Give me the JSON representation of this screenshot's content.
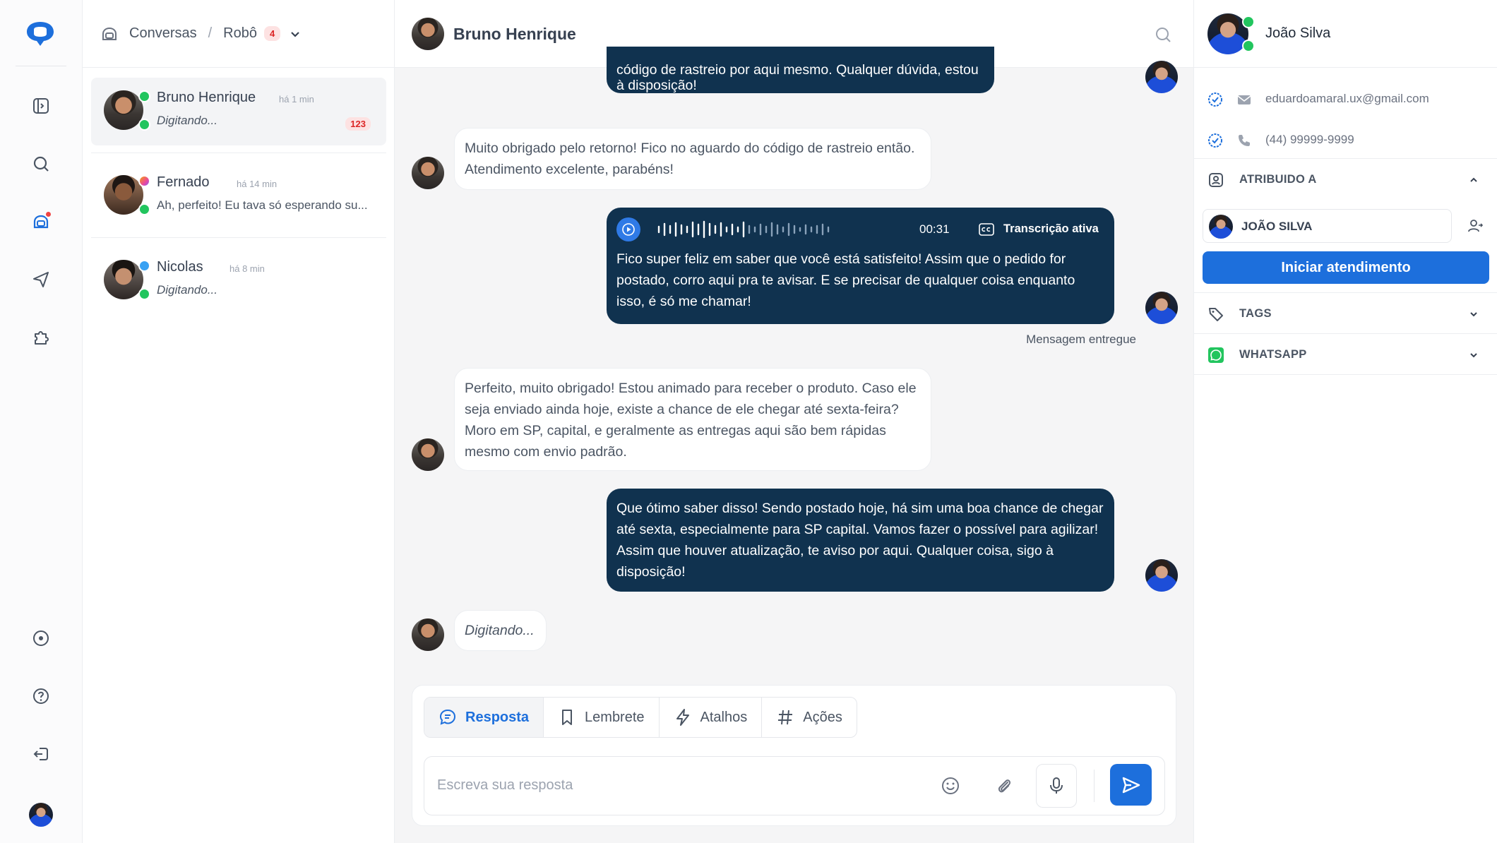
{
  "colors": {
    "accent": "#1d6fdc",
    "outgoing_bubble": "#10324f",
    "online": "#22c55e",
    "badge_bg": "#fde2e2",
    "badge_text": "#dc2626"
  },
  "rail": {
    "icons": [
      "chat-logo-icon",
      "panel-toggle-icon",
      "search-icon",
      "robot-icon",
      "send-icon",
      "puzzle-icon",
      "help-circle-icon",
      "question-icon",
      "logout-icon",
      "user-avatar"
    ]
  },
  "breadcrumb": {
    "root": "Conversas",
    "current": "Robô",
    "count": "4"
  },
  "conversations": [
    {
      "name": "Bruno Henrique",
      "time": "há 1 min",
      "preview": "Digitando...",
      "unread": "123",
      "channel": "whatsapp"
    },
    {
      "name": "Fernado",
      "time": "há 14 min",
      "preview": "Ah, perfeito! Eu tava só esperando su...",
      "unread": "",
      "channel": "instagram"
    },
    {
      "name": "Nicolas",
      "time": "há 8 min",
      "preview": "Digitando...",
      "unread": "",
      "channel": "telegram"
    }
  ],
  "chat": {
    "title": "Bruno Henrique",
    "messages": [
      {
        "dir": "out",
        "text": "código de rastreio por aqui mesmo. Qualquer dúvida, estou à disposição!"
      },
      {
        "dir": "in",
        "text": "Muito obrigado pelo retorno! Fico no aguardo do código de rastreio então. Atendimento excelente, parabéns!"
      },
      {
        "dir": "out",
        "type": "audio",
        "duration": "00:31",
        "transcription_label": "Transcrição ativa",
        "text": "Fico super feliz em saber que você está satisfeito! Assim que o pedido for postado, corro aqui pra te avisar. E se precisar de qualquer coisa enquanto isso, é só me chamar!"
      },
      {
        "dir": "in",
        "text": "Perfeito, muito obrigado! Estou animado para receber o produto. Caso ele seja enviado ainda hoje, existe a chance de ele chegar até sexta-feira? Moro em SP, capital, e geralmente as entregas aqui são bem rápidas mesmo com envio padrão."
      },
      {
        "dir": "out",
        "text": "Que ótimo saber disso! Sendo postado hoje, há sim uma boa chance de chegar até sexta, especialmente para SP capital. Vamos fazer o possível para agilizar! Assim que houver atualização, te aviso por aqui. Qualquer coisa, sigo à disposição!"
      },
      {
        "dir": "in",
        "text": "Digitando..."
      }
    ],
    "delivered_label": "Mensagem entregue"
  },
  "composer": {
    "tabs": [
      "Resposta",
      "Lembrete",
      "Atalhos",
      "Ações"
    ],
    "placeholder": "Escreva sua resposta"
  },
  "contact": {
    "name": "João Silva",
    "email": "eduardoamaral.ux@gmail.com",
    "phone": "(44) 99999-9999",
    "assigned_section": "ATRIBUIDO A",
    "assignee": "JOÃO SILVA",
    "start_button": "Iniciar atendimento",
    "tags_section": "TAGS",
    "whatsapp_section": "WHATSAPP"
  }
}
